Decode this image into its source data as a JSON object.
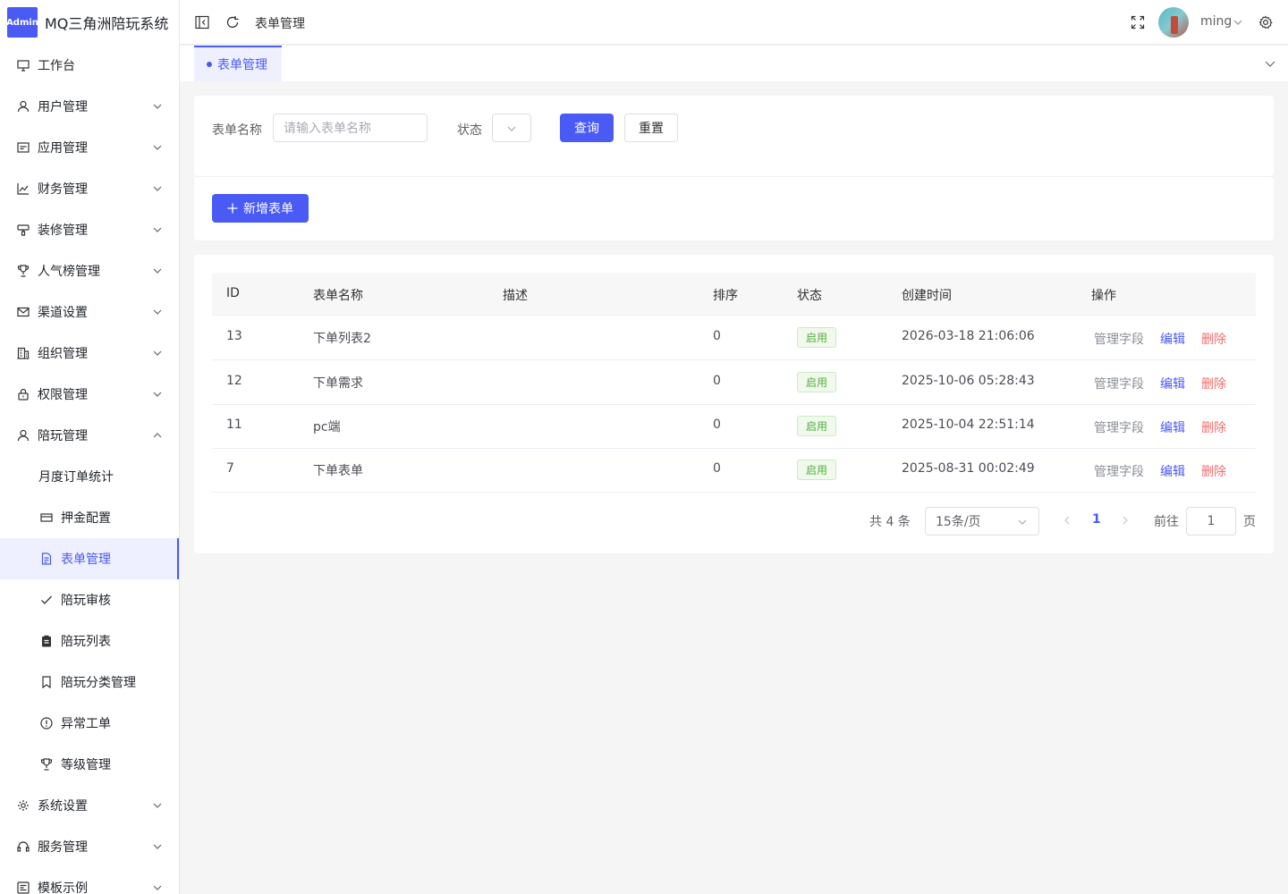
{
  "app": {
    "badge": "Admin",
    "title": "MQ三角洲陪玩系统",
    "brand_color": "#4a5af5"
  },
  "sidebar": {
    "items": [
      {
        "label": "工作台",
        "icon": "monitor-icon",
        "has_arrow": false
      },
      {
        "label": "用户管理",
        "icon": "user-icon",
        "has_arrow": true
      },
      {
        "label": "应用管理",
        "icon": "app-window-icon",
        "has_arrow": true
      },
      {
        "label": "财务管理",
        "icon": "chart-icon",
        "has_arrow": true
      },
      {
        "label": "装修管理",
        "icon": "paint-icon",
        "has_arrow": true
      },
      {
        "label": "人气榜管理",
        "icon": "trophy-icon",
        "has_arrow": true
      },
      {
        "label": "渠道设置",
        "icon": "mail-icon",
        "has_arrow": true
      },
      {
        "label": "组织管理",
        "icon": "building-icon",
        "has_arrow": true
      },
      {
        "label": "权限管理",
        "icon": "lock-icon",
        "has_arrow": true
      },
      {
        "label": "陪玩管理",
        "icon": "user-icon",
        "has_arrow": true,
        "expanded": true
      }
    ],
    "sub_items": [
      {
        "label": "月度订单统计",
        "icon": ""
      },
      {
        "label": "押金配置",
        "icon": "card-icon"
      },
      {
        "label": "表单管理",
        "icon": "document-icon",
        "active": true
      },
      {
        "label": "陪玩审核",
        "icon": "check-icon"
      },
      {
        "label": "陪玩列表",
        "icon": "clipboard-icon"
      },
      {
        "label": "陪玩分类管理",
        "icon": "bookmark-icon"
      },
      {
        "label": "异常工单",
        "icon": "alert-icon"
      },
      {
        "label": "等级管理",
        "icon": "trophy-icon"
      }
    ],
    "bottom_items": [
      {
        "label": "系统设置",
        "icon": "gear-icon"
      },
      {
        "label": "服务管理",
        "icon": "headset-icon"
      },
      {
        "label": "模板示例",
        "icon": "template-icon"
      }
    ]
  },
  "header": {
    "breadcrumb": "表单管理",
    "username": "ming"
  },
  "tabs": [
    {
      "label": "表单管理",
      "active": true
    }
  ],
  "search": {
    "name_label": "表单名称",
    "name_placeholder": "请输入表单名称",
    "status_label": "状态",
    "query_button": "查询",
    "reset_button": "重置"
  },
  "toolbar": {
    "add_button": "新增表单"
  },
  "table": {
    "columns": [
      "ID",
      "表单名称",
      "描述",
      "排序",
      "状态",
      "创建时间",
      "操作"
    ],
    "rows": [
      {
        "id": "13",
        "name": "下单列表2",
        "desc": "",
        "sort": "0",
        "status": "启用",
        "created": "2026-03-18 21:06:06"
      },
      {
        "id": "12",
        "name": "下单需求",
        "desc": "",
        "sort": "0",
        "status": "启用",
        "created": "2025-10-06 05:28:43"
      },
      {
        "id": "11",
        "name": "pc端",
        "desc": "",
        "sort": "0",
        "status": "启用",
        "created": "2025-10-04 22:51:14"
      },
      {
        "id": "7",
        "name": "下单表单",
        "desc": "",
        "sort": "0",
        "status": "启用",
        "created": "2025-08-31 00:02:49"
      }
    ],
    "actions": {
      "manage": "管理字段",
      "edit": "编辑",
      "delete": "删除"
    }
  },
  "pagination": {
    "total": "共 4 条",
    "page_size": "15条/页",
    "current": "1",
    "goto_label": "前往",
    "goto_value": "1",
    "page_suffix": "页"
  }
}
